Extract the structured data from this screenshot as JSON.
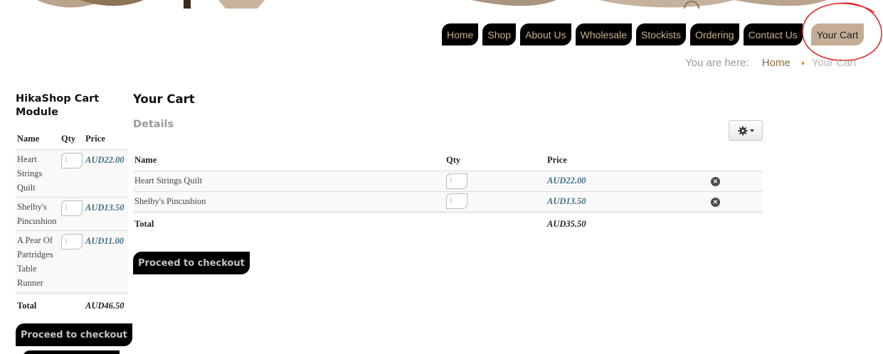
{
  "nav": {
    "items": [
      {
        "label": "Home"
      },
      {
        "label": "Shop"
      },
      {
        "label": "About Us"
      },
      {
        "label": "Wholesale"
      },
      {
        "label": "Stockists"
      },
      {
        "label": "Ordering"
      },
      {
        "label": "Contact Us"
      }
    ],
    "active": {
      "label": "Your Cart"
    }
  },
  "breadcrumb": {
    "prefix": "You are here:",
    "home": "Home",
    "current": "Your Cart"
  },
  "module": {
    "title": "HikaShop Cart Module",
    "columns": {
      "name": "Name",
      "qty": "Qty",
      "price": "Price"
    },
    "items": [
      {
        "name": "Heart Strings Quilt",
        "qty": "1",
        "price": "AUD22.00"
      },
      {
        "name": "Shelby's Pincushion",
        "qty": "1",
        "price": "AUD13.50"
      },
      {
        "name": "A Pear Of Partridges Table Runner",
        "qty": "1",
        "price": "AUD11.00"
      }
    ],
    "total_label": "Total",
    "total_value": "AUD46.50",
    "checkout_label": "Proceed to checkout"
  },
  "cart": {
    "title": "Your Cart",
    "section": "Details",
    "columns": {
      "name": "Name",
      "qty": "Qty",
      "price": "Price"
    },
    "items": [
      {
        "name": "Heart Strings Quilt",
        "qty": "1",
        "price": "AUD22.00"
      },
      {
        "name": "Shelby's Pincushion",
        "qty": "1",
        "price": "AUD13.50"
      }
    ],
    "total_label": "Total",
    "total_value": "AUD35.50",
    "checkout_label": "Proceed to checkout"
  },
  "icons": {
    "settings": "gear-icon",
    "remove": "remove-icon"
  },
  "colors": {
    "nav_bg": "#000000",
    "nav_text": "#c8b08a",
    "active_tab": "#c3ad94",
    "price_text": "#3e6f86",
    "annotation": "#e02020"
  }
}
